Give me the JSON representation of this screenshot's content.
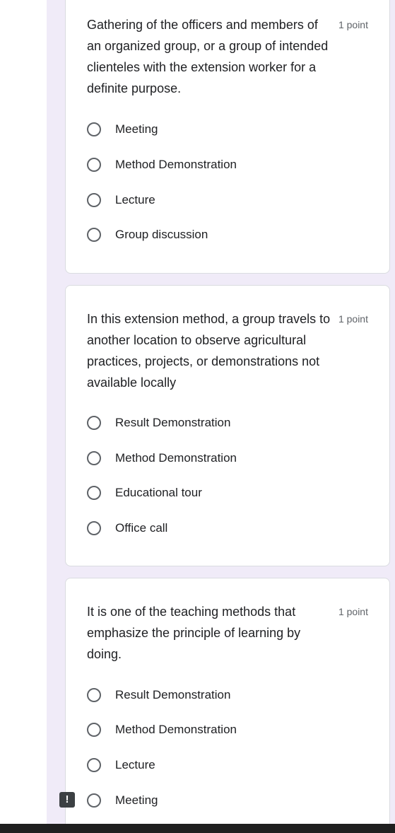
{
  "questions": [
    {
      "text": "Gathering of the officers and members of an organized group, or a group of intended clienteles with the extension worker for a definite purpose.",
      "points": "1 point",
      "options": [
        "Meeting",
        "Method Demonstration",
        "Lecture",
        "Group discussion"
      ]
    },
    {
      "text": " In this extension method, a group travels to another location to observe agricultural practices, projects, or demonstrations not available locally",
      "points": "1 point",
      "options": [
        "Result Demonstration",
        "Method Demonstration",
        "Educational tour",
        "Office call"
      ]
    },
    {
      "text": "It is one of the teaching methods that emphasize the principle of learning by doing.",
      "points": "1 point",
      "options": [
        "Result Demonstration",
        "Method Demonstration",
        "Lecture",
        "Meeting"
      ]
    }
  ],
  "alert_icon": {
    "glyph": "!"
  }
}
